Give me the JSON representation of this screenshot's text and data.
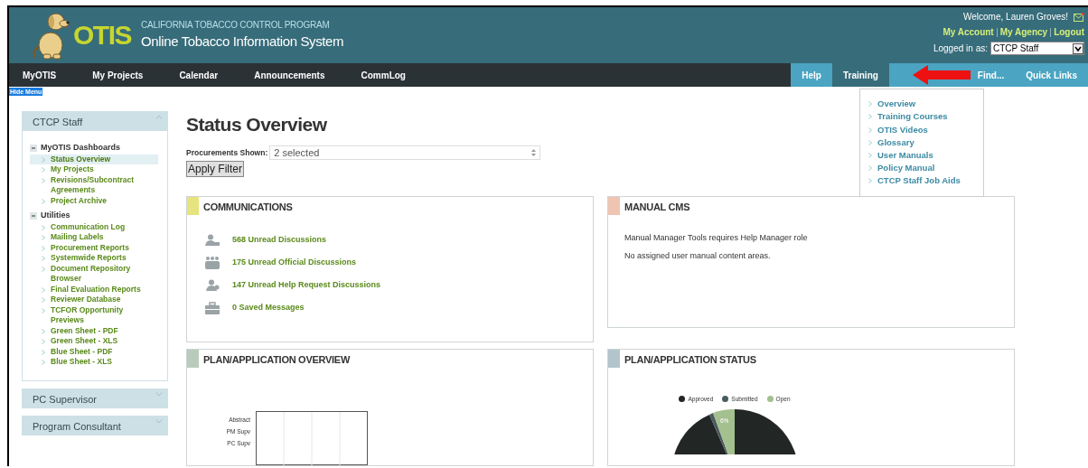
{
  "header": {
    "program": "CALIFORNIA TOBACCO CONTROL PROGRAM",
    "system": "Online Tobacco Information System",
    "logo_text": "OTIS",
    "welcome": "Welcome, Lauren Groves!",
    "account_links": [
      "My Account",
      "My Agency",
      "Logout"
    ],
    "logged_in_label": "Logged in as:",
    "role": "CTCP Staff"
  },
  "nav": {
    "left": [
      {
        "label": "MyOTIS",
        "selected": false
      },
      {
        "label": "My Projects",
        "selected": false
      },
      {
        "label": "Calendar",
        "selected": false
      },
      {
        "label": "Announcements",
        "selected": false
      },
      {
        "label": "CommLog",
        "selected": false
      }
    ],
    "right": [
      {
        "label": "Help",
        "selected": false
      },
      {
        "label": "Training",
        "selected": true
      },
      {
        "label": "Find...",
        "selected": false
      },
      {
        "label": "Quick Links",
        "selected": false
      }
    ]
  },
  "training_menu": [
    "Overview",
    "Training Courses",
    "OTIS Videos",
    "Glossary",
    "User Manuals",
    "Policy Manual",
    "CTCP Staff Job Aids"
  ],
  "hide_menu": "Hide Menu",
  "sidebar": [
    {
      "title": "CTCP Staff",
      "expanded": true,
      "groups": [
        {
          "label": "MyOTIS Dashboards",
          "expanded": true,
          "children": [
            {
              "label": "Status Overview",
              "selected": true
            },
            {
              "label": "My Projects",
              "selected": false
            },
            {
              "label": "Revisions/Subcontract Agreements",
              "selected": false
            },
            {
              "label": "Project Archive",
              "selected": false
            }
          ]
        },
        {
          "label": "Utilities",
          "expanded": true,
          "children": [
            {
              "label": "Communication Log",
              "selected": false
            },
            {
              "label": "Mailing Labels",
              "selected": false
            },
            {
              "label": "Procurement Reports",
              "selected": false
            },
            {
              "label": "Systemwide Reports",
              "selected": false
            },
            {
              "label": "Document Repository Browser",
              "selected": false
            },
            {
              "label": "Final Evaluation Reports",
              "selected": false
            },
            {
              "label": "Reviewer Database",
              "selected": false
            },
            {
              "label": "TCFOR Opportunity Previews",
              "selected": false
            },
            {
              "label": "Green Sheet - PDF",
              "selected": false
            },
            {
              "label": "Green Sheet - XLS",
              "selected": false
            },
            {
              "label": "Blue Sheet - PDF",
              "selected": false
            },
            {
              "label": "Blue Sheet - XLS",
              "selected": false
            }
          ]
        }
      ]
    },
    {
      "title": "PC Supervisor",
      "expanded": false
    },
    {
      "title": "Program Consultant",
      "expanded": false
    }
  ],
  "page_title": "Status Overview",
  "filter": {
    "label": "Procurements Shown:",
    "value": "2 selected",
    "button": "Apply Filter"
  },
  "communications": {
    "title": "COMMUNICATIONS",
    "color": "#e6e47e",
    "items": [
      {
        "kind": "user",
        "label": "568 Unread Discussions"
      },
      {
        "kind": "group",
        "label": "175 Unread Official Discussions"
      },
      {
        "kind": "help",
        "label": "147 Unread Help Request Discussions"
      },
      {
        "kind": "briefcase",
        "label": "0 Saved Messages"
      }
    ]
  },
  "manual_cms": {
    "title": "MANUAL CMS",
    "color": "#efc5b2",
    "lines": [
      "Manual Manager Tools requires Help Manager role",
      "No assigned user manual content areas."
    ]
  },
  "plan_overview": {
    "title": "PLAN/APPLICATION OVERVIEW",
    "color": "#b9ccbb",
    "axis_labels": [
      "Abstract",
      "PM Supv",
      "PC Supv"
    ]
  },
  "plan_status": {
    "title": "PLAN/APPLICATION STATUS",
    "color": "#b3c4cc",
    "legend": [
      {
        "label": "Approved",
        "color": "#222625"
      },
      {
        "label": "Submitted",
        "color": "#4a5b60"
      },
      {
        "label": "Open",
        "color": "#a3c08e"
      }
    ],
    "slice_label": "6%"
  }
}
